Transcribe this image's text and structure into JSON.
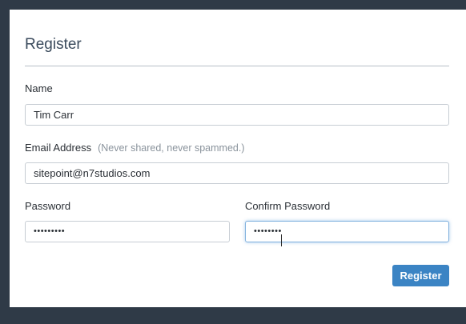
{
  "form": {
    "title": "Register",
    "name": {
      "label": "Name",
      "value": "Tim Carr"
    },
    "email": {
      "label": "Email Address",
      "hint": "(Never shared, never spammed.)",
      "value": "sitepoint@n7studios.com"
    },
    "password": {
      "label": "Password",
      "value": "•••••••••"
    },
    "confirm_password": {
      "label": "Confirm Password",
      "value": "••••••••"
    },
    "submit_label": "Register"
  },
  "colors": {
    "background": "#2f3a47",
    "card": "#ffffff",
    "button": "#3b84c4",
    "focus_border": "#7fb0dd"
  }
}
